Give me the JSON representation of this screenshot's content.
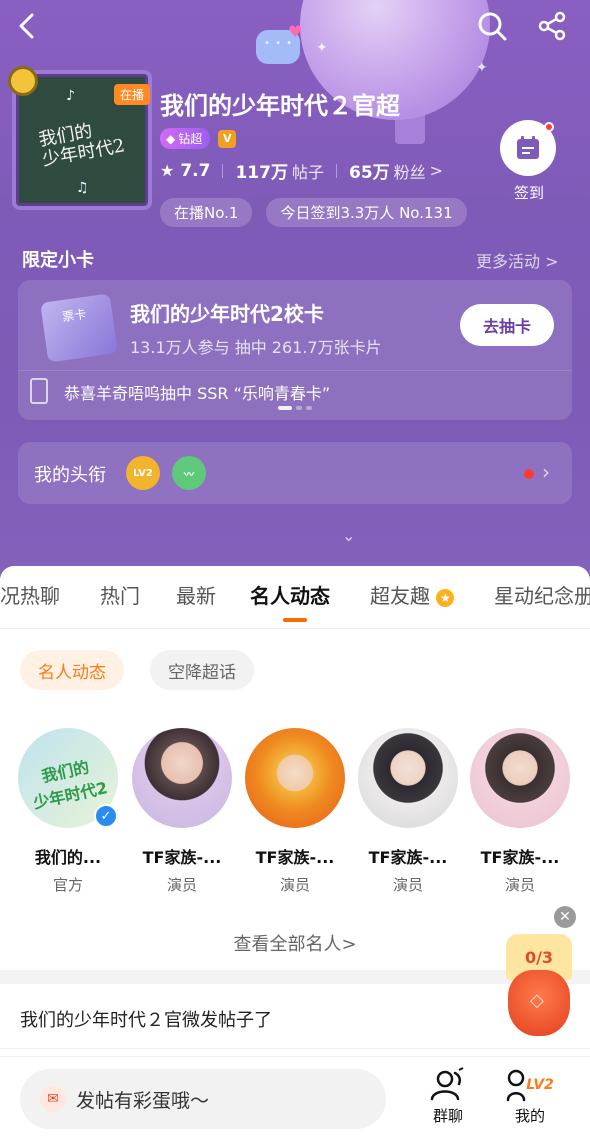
{
  "header": {
    "title": "我们的少年时代２官超",
    "live_tag": "在播",
    "diamond_badge": "钻超",
    "verified_letter": "V",
    "stats": {
      "rating": "7.7",
      "posts_num": "117万",
      "posts_label": "帖子",
      "fans_num": "65万",
      "fans_label": "粉丝",
      "fans_chevron": ">"
    },
    "pills": [
      "在播No.1",
      "今日签到3.3万人 No.131"
    ],
    "checkin_label": "签到"
  },
  "limited_cards": {
    "section_title": "限定小卡",
    "more_label": "更多活动 >",
    "card_title": "我们的少年时代2校卡",
    "card_sub": "13.1万人参与  抽中 261.7万张卡片",
    "draw_button": "去抽卡",
    "ticker": "恭喜羊奇唔呜抽中 SSR “乐响青春卡”"
  },
  "my_title": {
    "label": "我的头衔",
    "lv_badge": "LV2"
  },
  "tabs": [
    {
      "label": "况热聊"
    },
    {
      "label": "热门"
    },
    {
      "label": "最新"
    },
    {
      "label": "名人动态"
    },
    {
      "label": "超友趣"
    },
    {
      "label": "星动纪念册"
    }
  ],
  "chips": {
    "active": "名人动态",
    "inactive": "空降超话"
  },
  "celebrities": [
    {
      "name": "我们的...",
      "role": "官方"
    },
    {
      "name": "TF家族-...",
      "role": "演员"
    },
    {
      "name": "TF家族-...",
      "role": "演员"
    },
    {
      "name": "TF家族-...",
      "role": "演员"
    },
    {
      "name": "TF家族-...",
      "role": "演员"
    }
  ],
  "view_all": "查看全部名人>",
  "post_notice": "我们的少年时代２官微发帖子了",
  "float_task": {
    "count": "0/3"
  },
  "bottom": {
    "post_placeholder": "发帖有彩蛋哦～",
    "group_chat": "群聊",
    "me": "我的",
    "lv_text": "LV2"
  },
  "colors": {
    "hero_purple": "#7f5bb8",
    "accent_orange": "#ff6a00",
    "verified_blue": "#2a8cf0"
  }
}
